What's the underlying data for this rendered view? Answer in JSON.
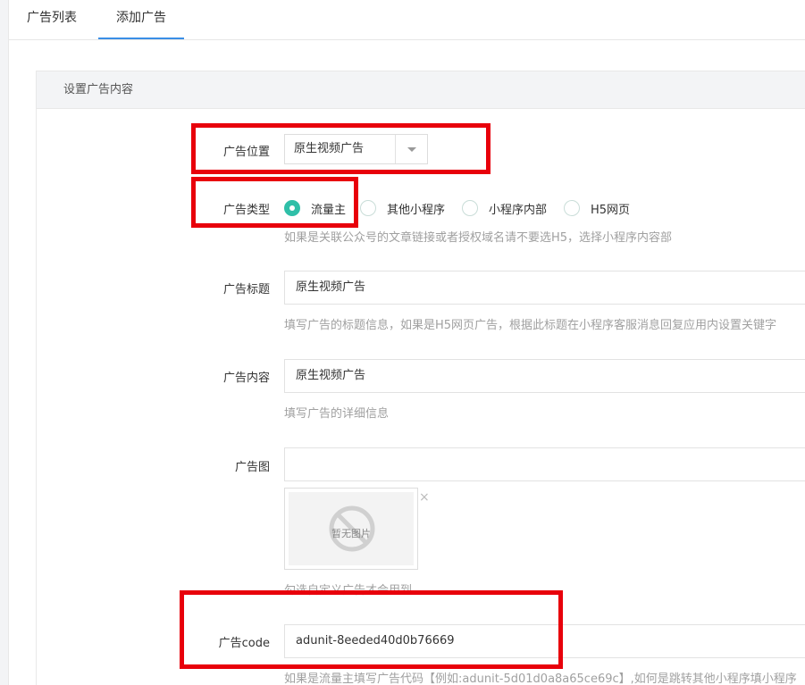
{
  "tabs": [
    {
      "label": "广告列表"
    },
    {
      "label": "添加广告"
    }
  ],
  "panel": {
    "title": "设置广告内容"
  },
  "form": {
    "position": {
      "label": "广告位置",
      "value": "原生视频广告"
    },
    "type": {
      "label": "广告类型",
      "options": [
        "流量主",
        "其他小程序",
        "小程序内部",
        "H5网页"
      ],
      "selected": "流量主",
      "hint": "如果是关联公众号的文章链接或者授权域名请不要选H5，选择小程序内容部"
    },
    "title": {
      "label": "广告标题",
      "value": "原生视频广告",
      "hint": "填写广告的标题信息，如果是H5网页广告，根据此标题在小程序客服消息回复应用内设置关键字"
    },
    "content": {
      "label": "广告内容",
      "value": "原生视频广告",
      "hint": "填写广告的详细信息"
    },
    "image": {
      "label": "广告图",
      "value": "",
      "placeholder_text": "暂无图片",
      "close": "×",
      "hint": "勾选自定义广告才会用到"
    },
    "code": {
      "label": "广告code",
      "value": "adunit-8eeded40d0b76669",
      "hint": "如果是流量主填写广告代码【例如:adunit-5d01d0a8a65ce69c】,如何是跳转其他小程序填小程序"
    }
  },
  "colors": {
    "accent": "#2fbfa8",
    "tab_active": "#3a8ee6",
    "highlight": "#e8000b"
  }
}
